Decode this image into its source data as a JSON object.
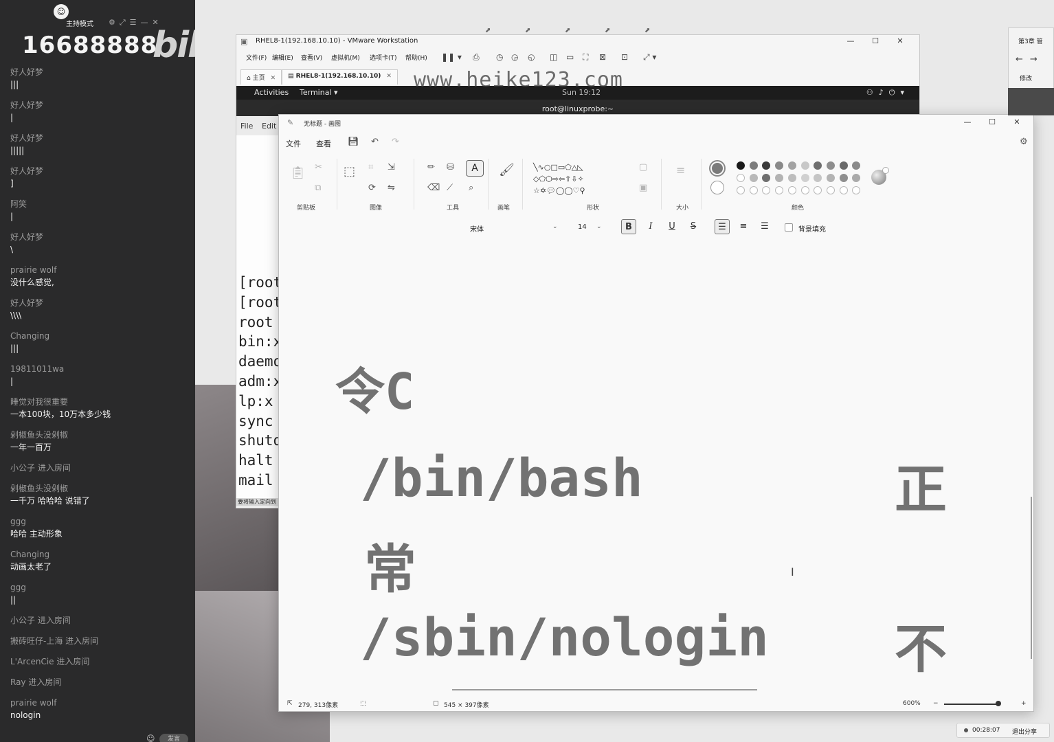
{
  "chat": {
    "host_mode": "主持模式",
    "viewer_count": "16688888",
    "platform_logo": "bilibili",
    "messages": [
      {
        "user": "好人好梦",
        "text": "|||"
      },
      {
        "user": "好人好梦",
        "text": "|"
      },
      {
        "user": "好人好梦",
        "text": "|||||"
      },
      {
        "user": "好人好梦",
        "text": "]"
      },
      {
        "user": "阿笑",
        "text": "|"
      },
      {
        "user": "好人好梦",
        "text": "\\"
      },
      {
        "user": "prairie wolf",
        "text": "没什么感觉,"
      },
      {
        "user": "好人好梦",
        "text": "\\\\\\\\"
      },
      {
        "user": "Changing",
        "text": "|||"
      },
      {
        "user": "19811011wa",
        "text": "|"
      },
      {
        "user": "睡觉对我很重要",
        "text": "一本100块，10万本多少钱"
      },
      {
        "user": "剁椒鱼头没剁椒",
        "text": "一年一百万"
      }
    ],
    "join1": "小公子 进入房间",
    "messages2": [
      {
        "user": "剁椒鱼头没剁椒",
        "text": "一千万   哈哈哈   说错了"
      },
      {
        "user": "ggg",
        "text": "哈哈 主动形象"
      },
      {
        "user": "Changing",
        "text": "动画太老了"
      },
      {
        "user": "ggg",
        "text": "||"
      }
    ],
    "joins": [
      "小公子 进入房间",
      "搬砖旺仔-上海 进入房间",
      "L'ArcenCie 进入房间",
      "Ray 进入房间"
    ],
    "last": {
      "user": "prairie wolf",
      "text": "nologin"
    },
    "send_label": "发言"
  },
  "vmware": {
    "title": "RHEL8-1(192.168.10.10) - VMware Workstation",
    "menu": [
      "文件(F)",
      "编辑(E)",
      "查看(V)",
      "虚拟机(M)",
      "选项卡(T)",
      "帮助(H)"
    ],
    "tabs": [
      "主页",
      "RHEL8-1(192.168.10.10)"
    ],
    "watermark": "www.heike123.com",
    "guest": {
      "activities": "Activities",
      "terminal_menu": "Terminal ▾",
      "clock": "Sun 19:12",
      "term_title": "root@linuxprobe:~",
      "term_menu": [
        "File",
        "Edit"
      ],
      "lines": [
        "[root",
        "[root",
        "root",
        "bin:x",
        "daemo",
        "adm:x",
        "lp:x",
        "sync",
        "shutd",
        "halt",
        "mail"
      ],
      "status": "要将输入定向到"
    }
  },
  "paint": {
    "title": "无标题 - 画图",
    "menu": [
      "文件",
      "查看"
    ],
    "groups": {
      "clipboard": "剪贴板",
      "image": "图像",
      "tools": "工具",
      "brushes": "画笔",
      "shapes": "形状",
      "size": "大小",
      "colors": "颜色"
    },
    "text_tool": "A",
    "font": "宋体",
    "font_size": "14",
    "format": {
      "bold": "B",
      "italic": "I",
      "underline": "U",
      "strike": "S"
    },
    "bg_fill": "背景填充",
    "canvas": {
      "line1": "令C",
      "line2": "/bin/bash",
      "line2_right": "正",
      "line3": "常",
      "line4": "/sbin/nologin",
      "line4_right": "不"
    },
    "status": {
      "cursor_pos": "279, 313像素",
      "canvas_size": "545 × 397像素",
      "zoom": "600%"
    },
    "colors": {
      "primary": "#7a7a7a",
      "row1": [
        "#1a1a1a",
        "#7d7d7d",
        "#3a3a3a",
        "#8a8a8a",
        "#a3a3a3",
        "#c8c8c8",
        "#6e6e6e",
        "#8e8e8e",
        "#6a6a6a",
        "#8a8a8a"
      ],
      "row2": [
        "",
        "#b8b8b8",
        "#6e6e6e",
        "#b3b3b3",
        "#bdbdbd",
        "#d0d0d0",
        "#c5c5c5",
        "#b3b3b3",
        "#8e8e8e",
        "#aaaaaa"
      ]
    }
  },
  "browser": {
    "tab": "第3章 管",
    "edit": "修改"
  },
  "recording": {
    "time": "00:28:07",
    "exit": "退出分享"
  }
}
